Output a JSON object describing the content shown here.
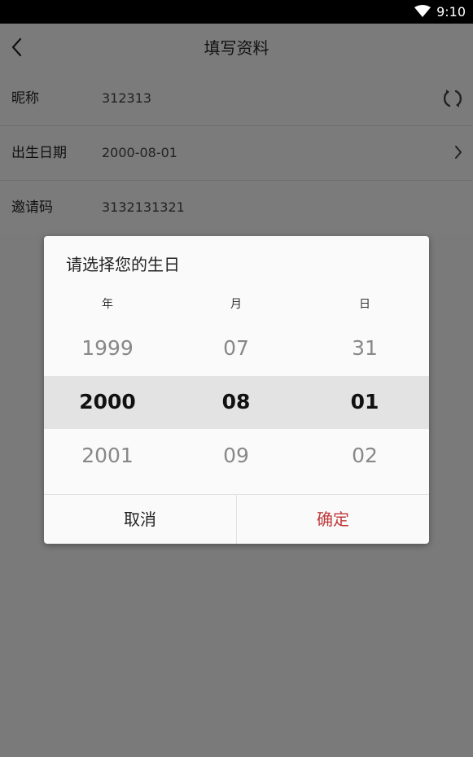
{
  "statusbar": {
    "time": "9:10"
  },
  "header": {
    "title": "填写资料"
  },
  "form": {
    "rows": [
      {
        "label": "昵称",
        "value": "312313"
      },
      {
        "label": "出生日期",
        "value": "2000-08-01"
      },
      {
        "label": "邀请码",
        "value": "3132131321"
      }
    ]
  },
  "dialog": {
    "title": "请选择您的生日",
    "columns": {
      "year": {
        "header": "年",
        "prev": "1999",
        "selected": "2000",
        "next": "2001"
      },
      "month": {
        "header": "月",
        "prev": "07",
        "selected": "08",
        "next": "09"
      },
      "day": {
        "header": "日",
        "prev": "31",
        "selected": "01",
        "next": "02"
      }
    },
    "cancel_label": "取消",
    "confirm_label": "确定"
  },
  "colors": {
    "accent": "#c0393b",
    "overlay": "#7a7a7a"
  }
}
